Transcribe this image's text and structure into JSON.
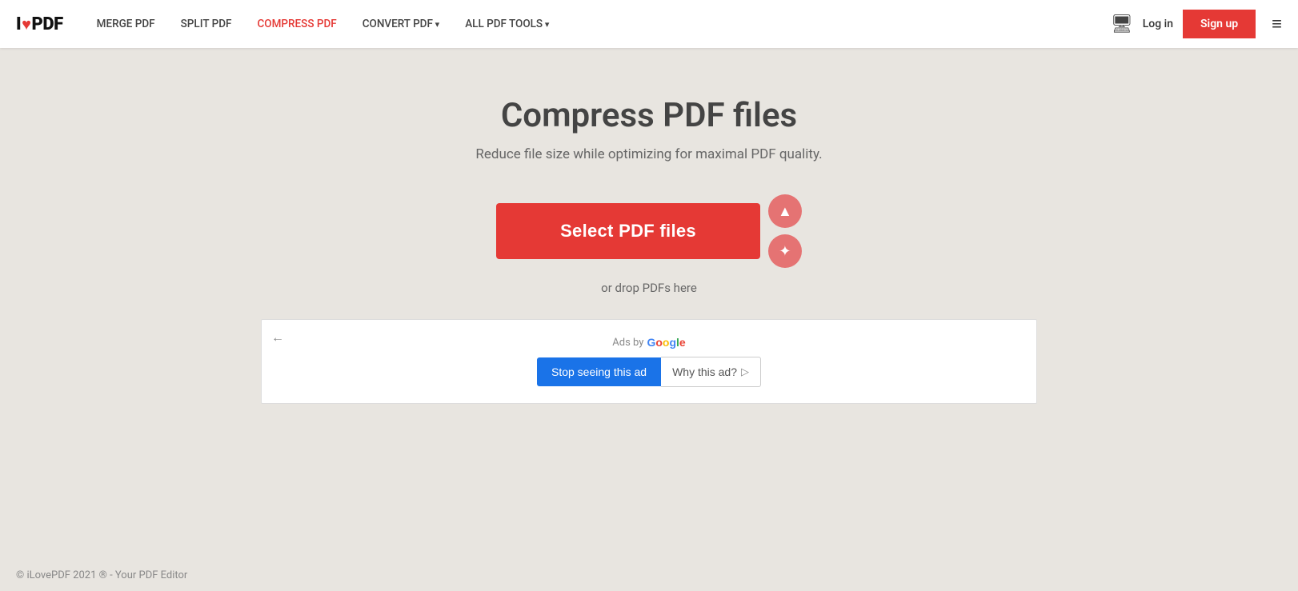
{
  "nav": {
    "logo_i": "I",
    "logo_heart": "♥",
    "logo_pdf": "PDF",
    "links": [
      {
        "label": "MERGE PDF",
        "active": false,
        "dropdown": false
      },
      {
        "label": "SPLIT PDF",
        "active": false,
        "dropdown": false
      },
      {
        "label": "COMPRESS PDF",
        "active": true,
        "dropdown": false
      },
      {
        "label": "CONVERT PDF",
        "active": false,
        "dropdown": true
      },
      {
        "label": "ALL PDF TOOLS",
        "active": false,
        "dropdown": true
      }
    ],
    "desktop_icon": "🖥",
    "login_label": "Log in",
    "signup_label": "Sign up",
    "hamburger": "≡"
  },
  "main": {
    "title": "Compress PDF files",
    "subtitle": "Reduce file size while optimizing for maximal PDF quality.",
    "select_btn_label": "Select PDF files",
    "drop_text": "or drop PDFs here",
    "cloud_gdrive_icon": "▲",
    "cloud_dropbox_icon": "✦"
  },
  "ad": {
    "back_arrow": "←",
    "ads_by_label": "Ads by",
    "google_label": "Google",
    "stop_ad_label": "Stop seeing this ad",
    "why_ad_label": "Why this ad?",
    "why_icon": "▷"
  },
  "footer": {
    "text": "© iLovePDF 2021 ® - Your PDF Editor"
  }
}
